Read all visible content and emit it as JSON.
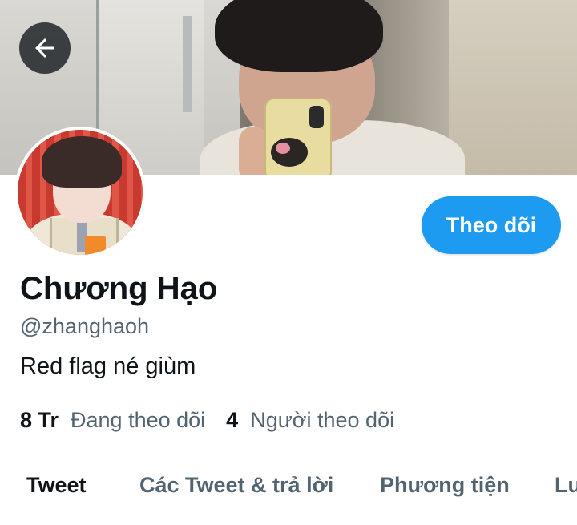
{
  "profile": {
    "name": "Chương Hạo",
    "handle": "@zhanghaoh",
    "bio": "Red flag né giùm",
    "following_count": "8 Tr",
    "following_label": "Đang theo dõi",
    "followers_count": "4",
    "followers_label": "Người theo dõi"
  },
  "actions": {
    "follow_label": "Theo dõi"
  },
  "tabs": [
    {
      "label": "Tweet",
      "active": true
    },
    {
      "label": "Các Tweet & trả lời",
      "active": false
    },
    {
      "label": "Phương tiện",
      "active": false
    },
    {
      "label": "Lư",
      "active": false
    }
  ],
  "icons": {
    "back": "arrow-left-icon"
  },
  "colors": {
    "accent": "#1d9bf0",
    "text_primary": "#0f1419",
    "text_secondary": "#536471"
  }
}
